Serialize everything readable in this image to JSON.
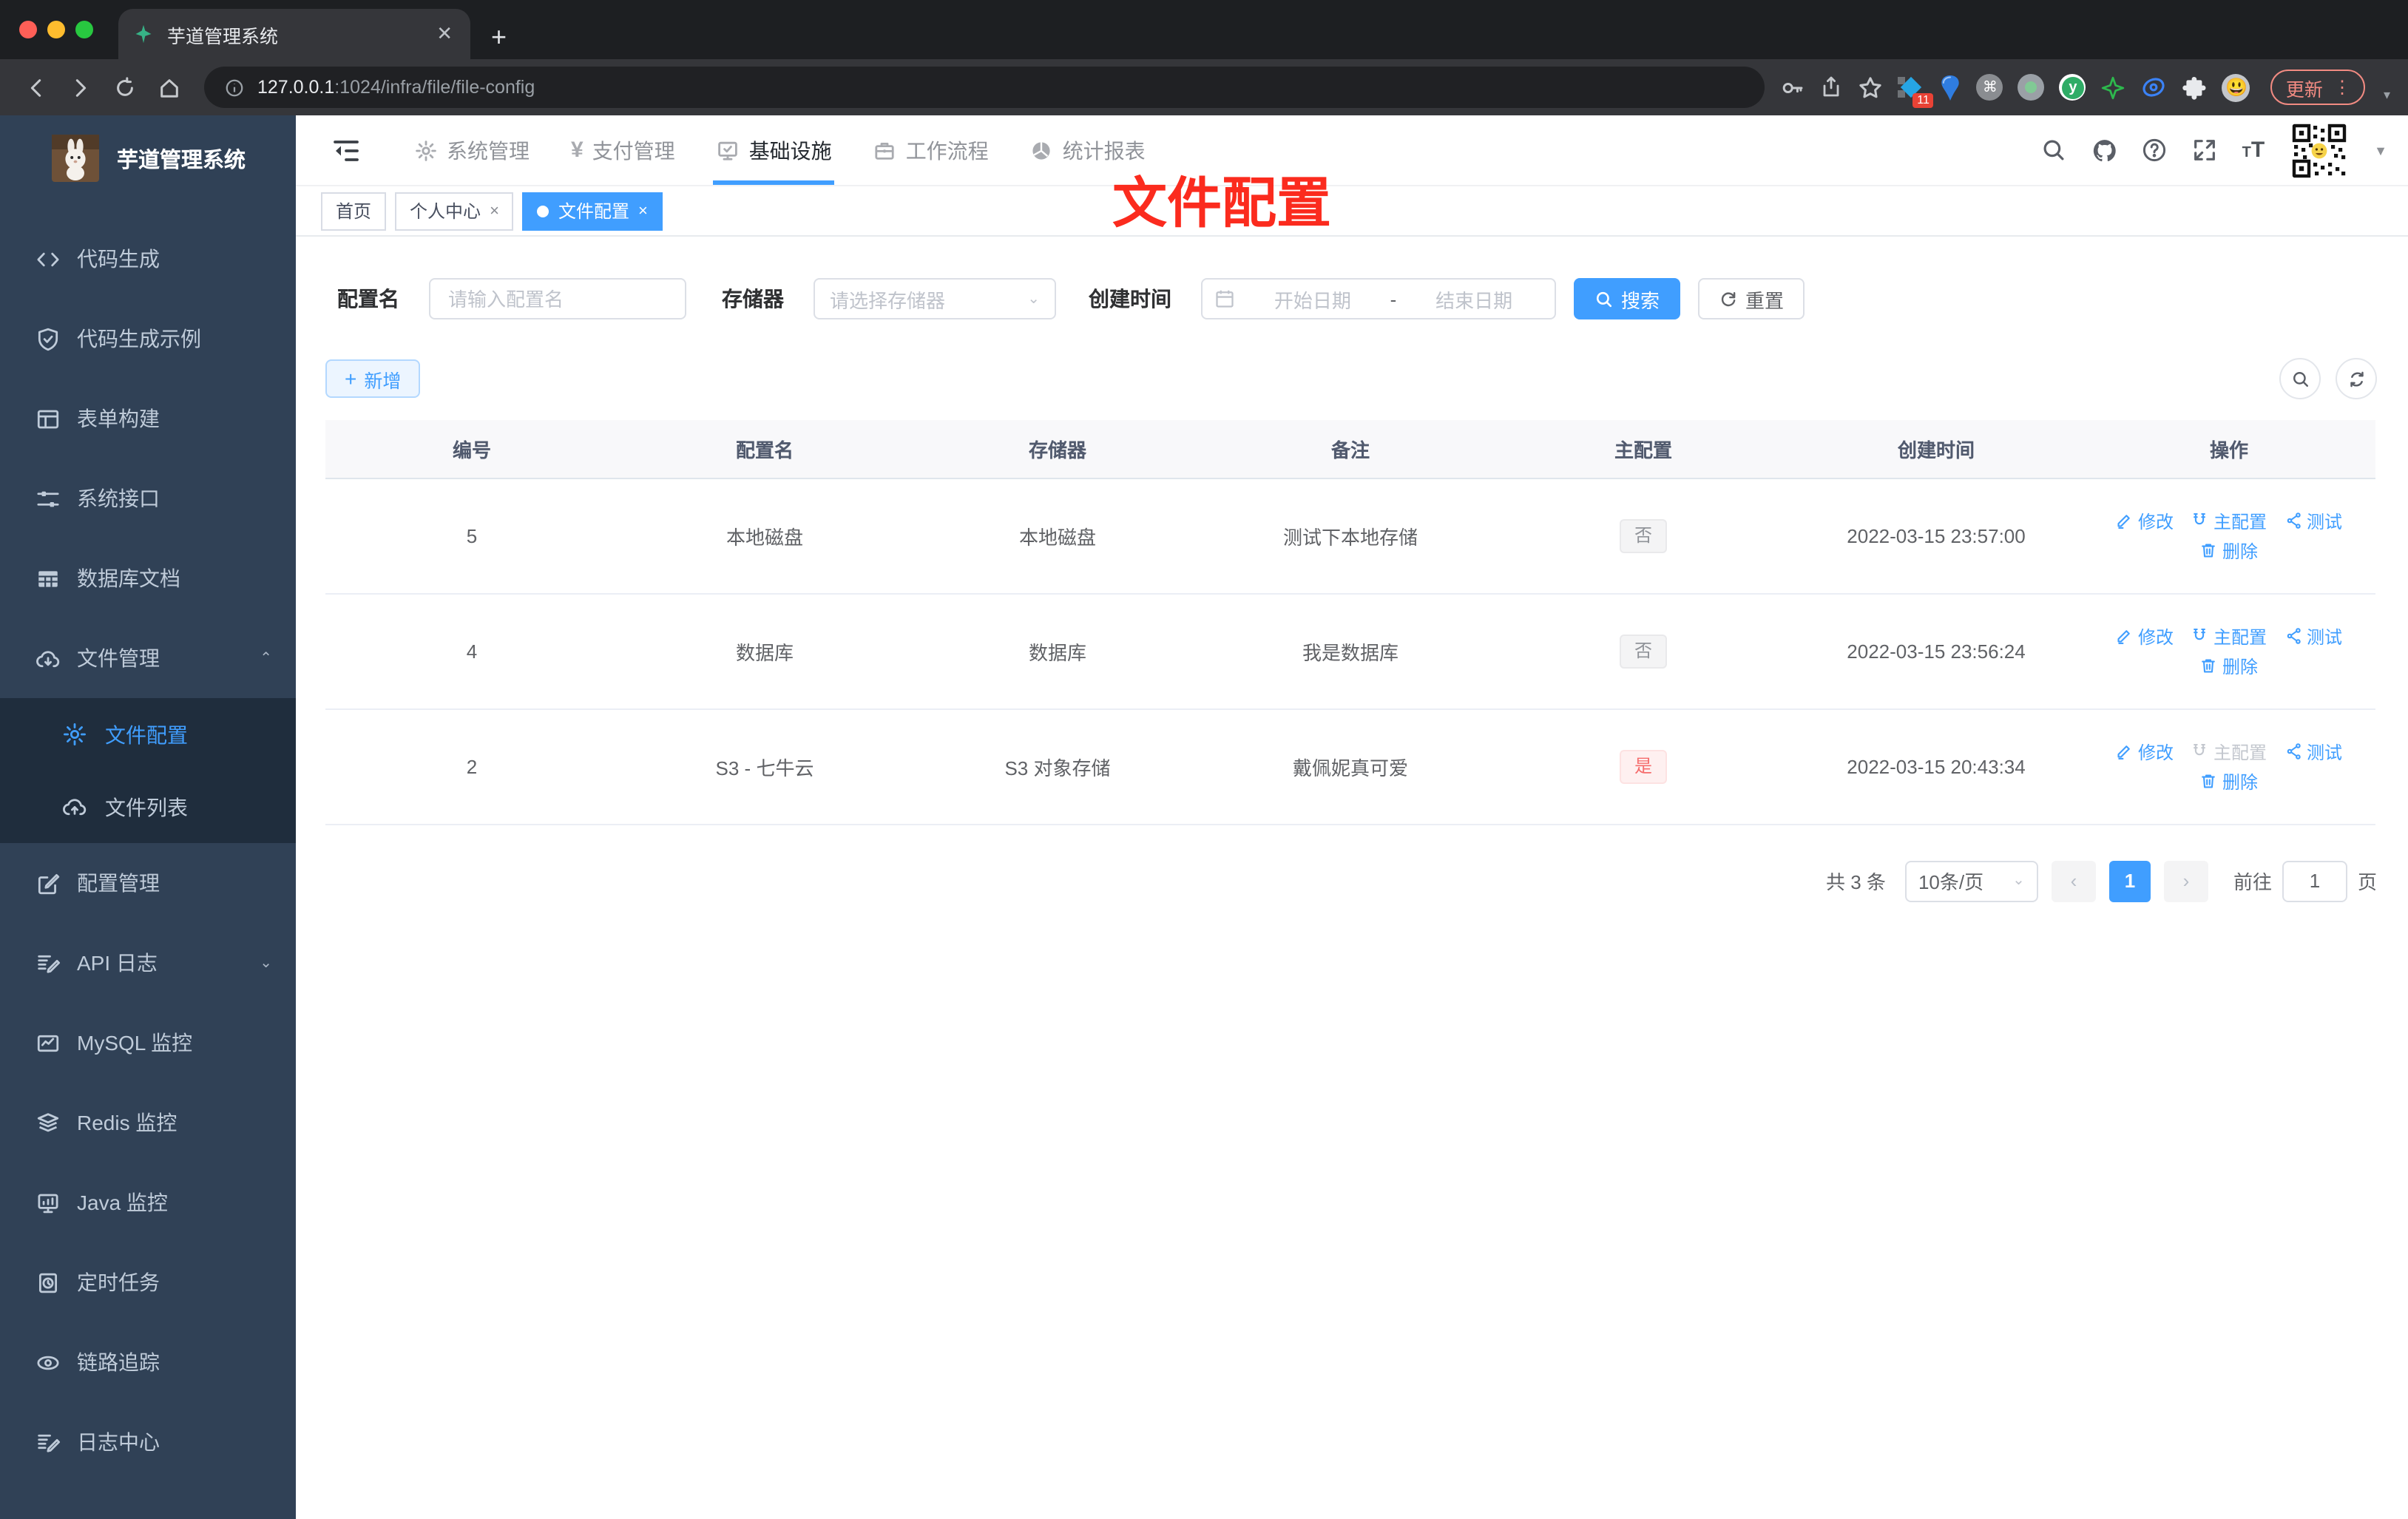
{
  "colors": {
    "accent": "#409eff",
    "sidebar_bg": "#304156",
    "submenu_bg": "#1f2d3d",
    "danger": "#f56c6c",
    "annotation_red": "#fb2b1e"
  },
  "browser": {
    "tab_title": "芋道管理系统",
    "new_tab_glyph": "+",
    "url_host": "127.0.0.1",
    "url_rest": ":1024/infra/file/file-config",
    "update_label": "更新",
    "extension_badge": "11",
    "extension_icons": [
      "pinned-widget-icon",
      "pin-icon",
      "command-icon",
      "recorder-icon",
      "y-extension-icon",
      "star-extension-icon",
      "eye-extension-icon",
      "puzzle-icon",
      "profile-emoji-icon"
    ]
  },
  "sidebar": {
    "title": "芋道管理系统",
    "items": [
      {
        "label": "代码生成",
        "icon": "code-icon"
      },
      {
        "label": "代码生成示例",
        "icon": "shield-check-icon"
      },
      {
        "label": "表单构建",
        "icon": "form-icon"
      },
      {
        "label": "系统接口",
        "icon": "sliders-icon"
      },
      {
        "label": "数据库文档",
        "icon": "table-icon"
      },
      {
        "label": "文件管理",
        "icon": "cloud-download-icon",
        "expanded": true
      },
      {
        "label": "文件配置",
        "icon": "gear-icon",
        "active": true,
        "submenu": true
      },
      {
        "label": "文件列表",
        "icon": "cloud-upload-icon",
        "submenu": true
      },
      {
        "label": "配置管理",
        "icon": "edit-square-icon"
      },
      {
        "label": "API 日志",
        "icon": "log-icon",
        "collapsed": true
      },
      {
        "label": "MySQL 监控",
        "icon": "chart-icon"
      },
      {
        "label": "Redis 监控",
        "icon": "layers-icon"
      },
      {
        "label": "Java 监控",
        "icon": "monitor-icon"
      },
      {
        "label": "定时任务",
        "icon": "timer-icon"
      },
      {
        "label": "链路追踪",
        "icon": "eye-icon"
      },
      {
        "label": "日志中心",
        "icon": "log-icon"
      }
    ]
  },
  "topnav": {
    "items": [
      {
        "label": "系统管理",
        "icon": "gear-icon"
      },
      {
        "label": "支付管理",
        "icon": "yen-icon"
      },
      {
        "label": "基础设施",
        "icon": "monitor-check-icon",
        "active": true
      },
      {
        "label": "工作流程",
        "icon": "briefcase-icon"
      },
      {
        "label": "统计报表",
        "icon": "pie-chart-icon"
      }
    ],
    "right_icons": [
      "search-icon",
      "github-icon",
      "help-icon",
      "fullscreen-icon",
      "font-size-icon",
      "avatar-qr",
      "caret-down-icon"
    ]
  },
  "tabsbar": {
    "tabs": [
      {
        "label": "首页"
      },
      {
        "label": "个人中心",
        "close": "×"
      },
      {
        "label": "文件配置",
        "close": "×",
        "active": true
      }
    ]
  },
  "annotation": {
    "text": "文件配置"
  },
  "filters": {
    "name_label": "配置名",
    "name_placeholder": "请输入配置名",
    "storage_label": "存储器",
    "storage_placeholder": "请选择存储器",
    "date_label": "创建时间",
    "date_start_placeholder": "开始日期",
    "date_separator": "-",
    "date_end_placeholder": "结束日期",
    "search_label": "搜索",
    "reset_label": "重置"
  },
  "toolbar": {
    "add_label": "新增"
  },
  "table": {
    "columns": [
      "编号",
      "配置名",
      "存储器",
      "备注",
      "主配置",
      "创建时间",
      "操作"
    ],
    "actions": {
      "edit": "修改",
      "master": "主配置",
      "test": "测试",
      "delete": "删除"
    },
    "rows": [
      {
        "id": "5",
        "name": "本地磁盘",
        "storage": "本地磁盘",
        "remark": "测试下本地存储",
        "master": "否",
        "created": "2022-03-15 23:57:00"
      },
      {
        "id": "4",
        "name": "数据库",
        "storage": "数据库",
        "remark": "我是数据库",
        "master": "否",
        "created": "2022-03-15 23:56:24"
      },
      {
        "id": "2",
        "name": "S3 - 七牛云",
        "storage": "S3 对象存储",
        "remark": "戴佩妮真可爱",
        "master": "是",
        "created": "2022-03-15 20:43:34"
      }
    ]
  },
  "pagination": {
    "total": "共 3 条",
    "page_size": "10条/页",
    "page": "1",
    "goto_label": "前往",
    "goto_value": "1",
    "unit_label": "页"
  }
}
